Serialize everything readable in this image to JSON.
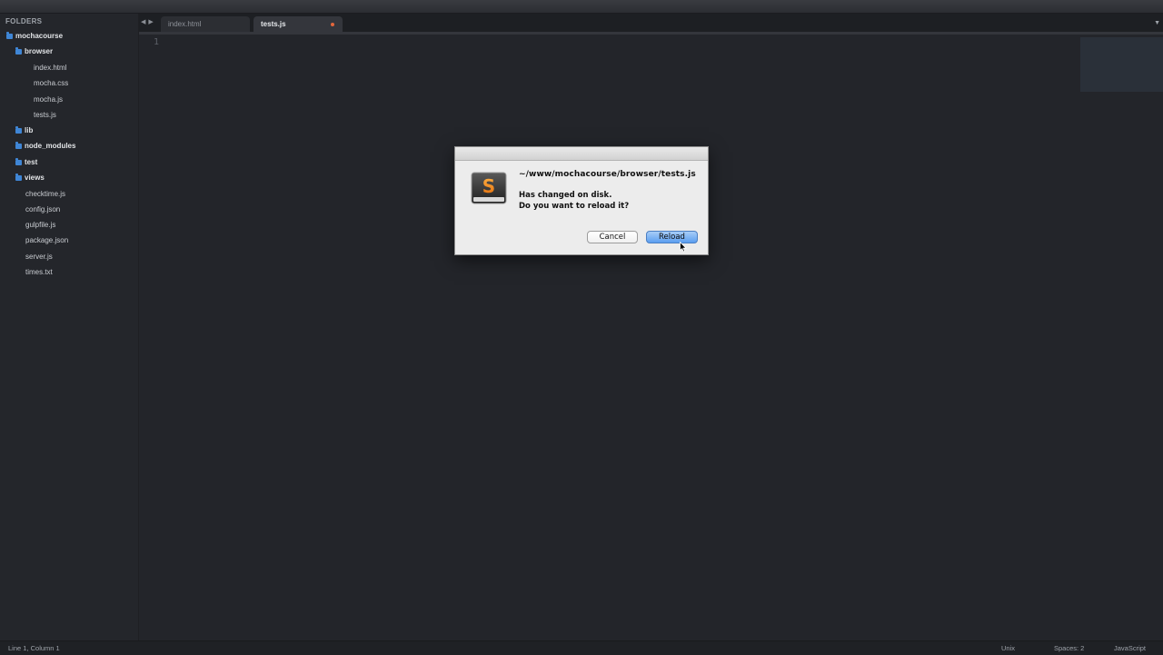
{
  "sidebar": {
    "header": "FOLDERS",
    "root": "mochacourse",
    "browser_folder": "browser",
    "browser_files": [
      "index.html",
      "mocha.css",
      "mocha.js",
      "tests.js"
    ],
    "folders": [
      "lib",
      "node_modules",
      "test",
      "views"
    ],
    "root_files": [
      "checktime.js",
      "config.json",
      "gulpfile.js",
      "package.json",
      "server.js",
      "times.txt"
    ]
  },
  "tabs": [
    {
      "label": "index.html",
      "active": false,
      "dirty": false
    },
    {
      "label": "tests.js",
      "active": true,
      "dirty": true
    }
  ],
  "editor": {
    "line_numbers": [
      "1"
    ]
  },
  "dialog": {
    "path": "~/www/mochacourse/browser/tests.js",
    "message_line1": "Has changed on disk.",
    "message_line2": "Do you want to reload it?",
    "cancel_label": "Cancel",
    "reload_label": "Reload",
    "app_icon_letter": "S"
  },
  "statusbar": {
    "position": "Line 1, Column 1",
    "line_endings": "Unix",
    "indentation": "Spaces: 2",
    "syntax": "JavaScript"
  },
  "colors": {
    "accent_folder": "#3f86d6",
    "dirty_dot": "#e2663b",
    "default_button": "#5b9ef0"
  },
  "icons": {
    "nav_back": "left-arrow-icon",
    "nav_forward": "right-arrow-icon",
    "tab_overflow": "chevron-down-icon",
    "folder": "folder-icon",
    "app": "sublime-text-icon",
    "cursor": "mouse-pointer-icon"
  }
}
